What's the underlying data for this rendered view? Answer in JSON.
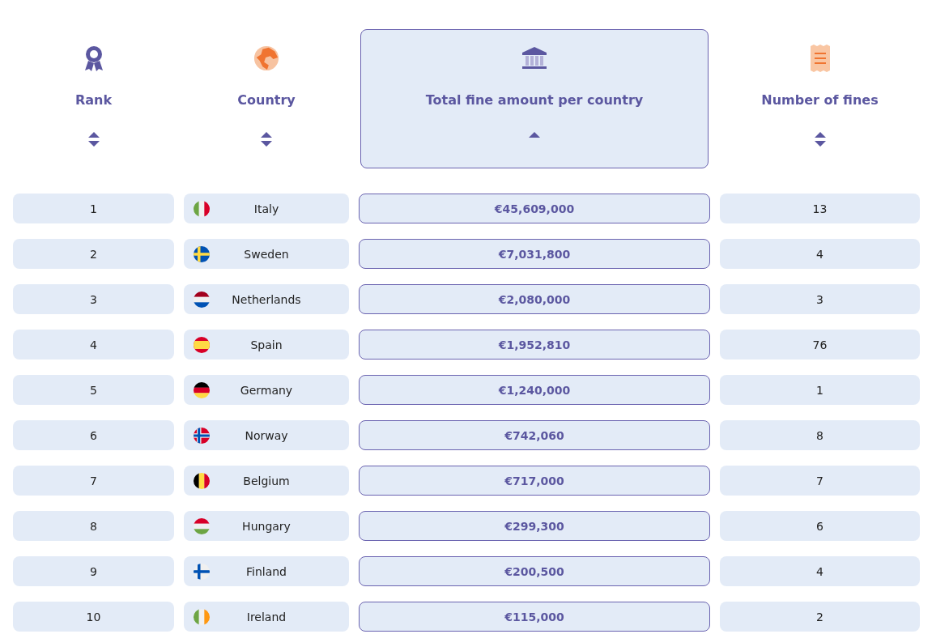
{
  "columns": [
    {
      "label": "Rank",
      "selected": false
    },
    {
      "label": "Country",
      "selected": false
    },
    {
      "label": "Total fine amount per country",
      "selected": true
    },
    {
      "label": "Number of fines",
      "selected": false
    }
  ],
  "rows": [
    {
      "rank": "1",
      "country": "Italy",
      "amount": "€45,609,000",
      "count": "13"
    },
    {
      "rank": "2",
      "country": "Sweden",
      "amount": "€7,031,800",
      "count": "4"
    },
    {
      "rank": "3",
      "country": "Netherlands",
      "amount": "€2,080,000",
      "count": "3"
    },
    {
      "rank": "4",
      "country": "Spain",
      "amount": "€1,952,810",
      "count": "76"
    },
    {
      "rank": "5",
      "country": "Germany",
      "amount": "€1,240,000",
      "count": "1"
    },
    {
      "rank": "6",
      "country": "Norway",
      "amount": "€742,060",
      "count": "8"
    },
    {
      "rank": "7",
      "country": "Belgium",
      "amount": "€717,000",
      "count": "7"
    },
    {
      "rank": "8",
      "country": "Hungary",
      "amount": "€299,300",
      "count": "6"
    },
    {
      "rank": "9",
      "country": "Finland",
      "amount": "€200,500",
      "count": "4"
    },
    {
      "rank": "10",
      "country": "Ireland",
      "amount": "€115,000",
      "count": "2"
    }
  ]
}
